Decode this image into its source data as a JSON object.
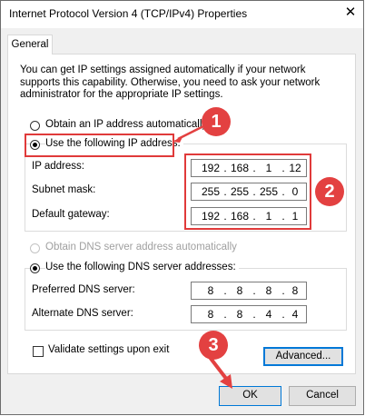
{
  "window": {
    "title": "Internet Protocol Version 4 (TCP/IPv4) Properties",
    "close_glyph": "✕"
  },
  "tabs": [
    {
      "label": "General"
    }
  ],
  "description": "You can get IP settings assigned automatically if your network supports this capability. Otherwise, you need to ask your network administrator for the appropriate IP settings.",
  "ip_section": {
    "auto_label": "Obtain an IP address automatically",
    "manual_label": "Use the following IP address:",
    "selected": "manual",
    "fields": [
      {
        "label": "IP address:",
        "octets": [
          "192",
          "168",
          "1",
          "12"
        ]
      },
      {
        "label": "Subnet mask:",
        "octets": [
          "255",
          "255",
          "255",
          "0"
        ]
      },
      {
        "label": "Default gateway:",
        "octets": [
          "192",
          "168",
          "1",
          "1"
        ]
      }
    ]
  },
  "dns_section": {
    "auto_label": "Obtain DNS server address automatically",
    "manual_label": "Use the following DNS server addresses:",
    "selected": "manual",
    "auto_disabled": true,
    "fields": [
      {
        "label": "Preferred DNS server:",
        "octets": [
          "8",
          "8",
          "8",
          "8"
        ]
      },
      {
        "label": "Alternate DNS server:",
        "octets": [
          "8",
          "8",
          "4",
          "4"
        ]
      }
    ]
  },
  "validate": {
    "label": "Validate settings upon exit",
    "checked": false
  },
  "buttons": {
    "advanced": "Advanced...",
    "ok": "OK",
    "cancel": "Cancel"
  },
  "annotations": {
    "badge_1": "1",
    "badge_2": "2",
    "badge_3": "3",
    "color": "#e34141"
  }
}
